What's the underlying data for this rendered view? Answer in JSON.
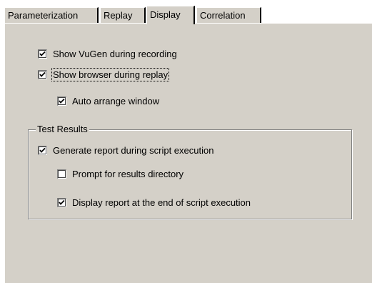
{
  "tabs": [
    {
      "label": "Parameterization",
      "active": false
    },
    {
      "label": "Replay",
      "active": false
    },
    {
      "label": "Display",
      "active": true
    },
    {
      "label": "Correlation",
      "active": false
    }
  ],
  "options": {
    "show_vugen": {
      "label": "Show VuGen during recording",
      "checked": true
    },
    "show_browser": {
      "label": "Show browser during replay",
      "checked": true
    },
    "auto_arrange": {
      "label": "Auto arrange window",
      "checked": true
    }
  },
  "test_results": {
    "title": "Test Results",
    "generate_report": {
      "label": "Generate report during script execution",
      "checked": true
    },
    "prompt_results_dir": {
      "label": "Prompt for results directory",
      "checked": false
    },
    "display_report": {
      "label": "Display report at the end of script execution",
      "checked": true
    }
  },
  "colors": {
    "dialog_face": "#d4d0c8",
    "highlight": "#ffffff",
    "shadow": "#808080",
    "dark_shadow": "#404040"
  }
}
